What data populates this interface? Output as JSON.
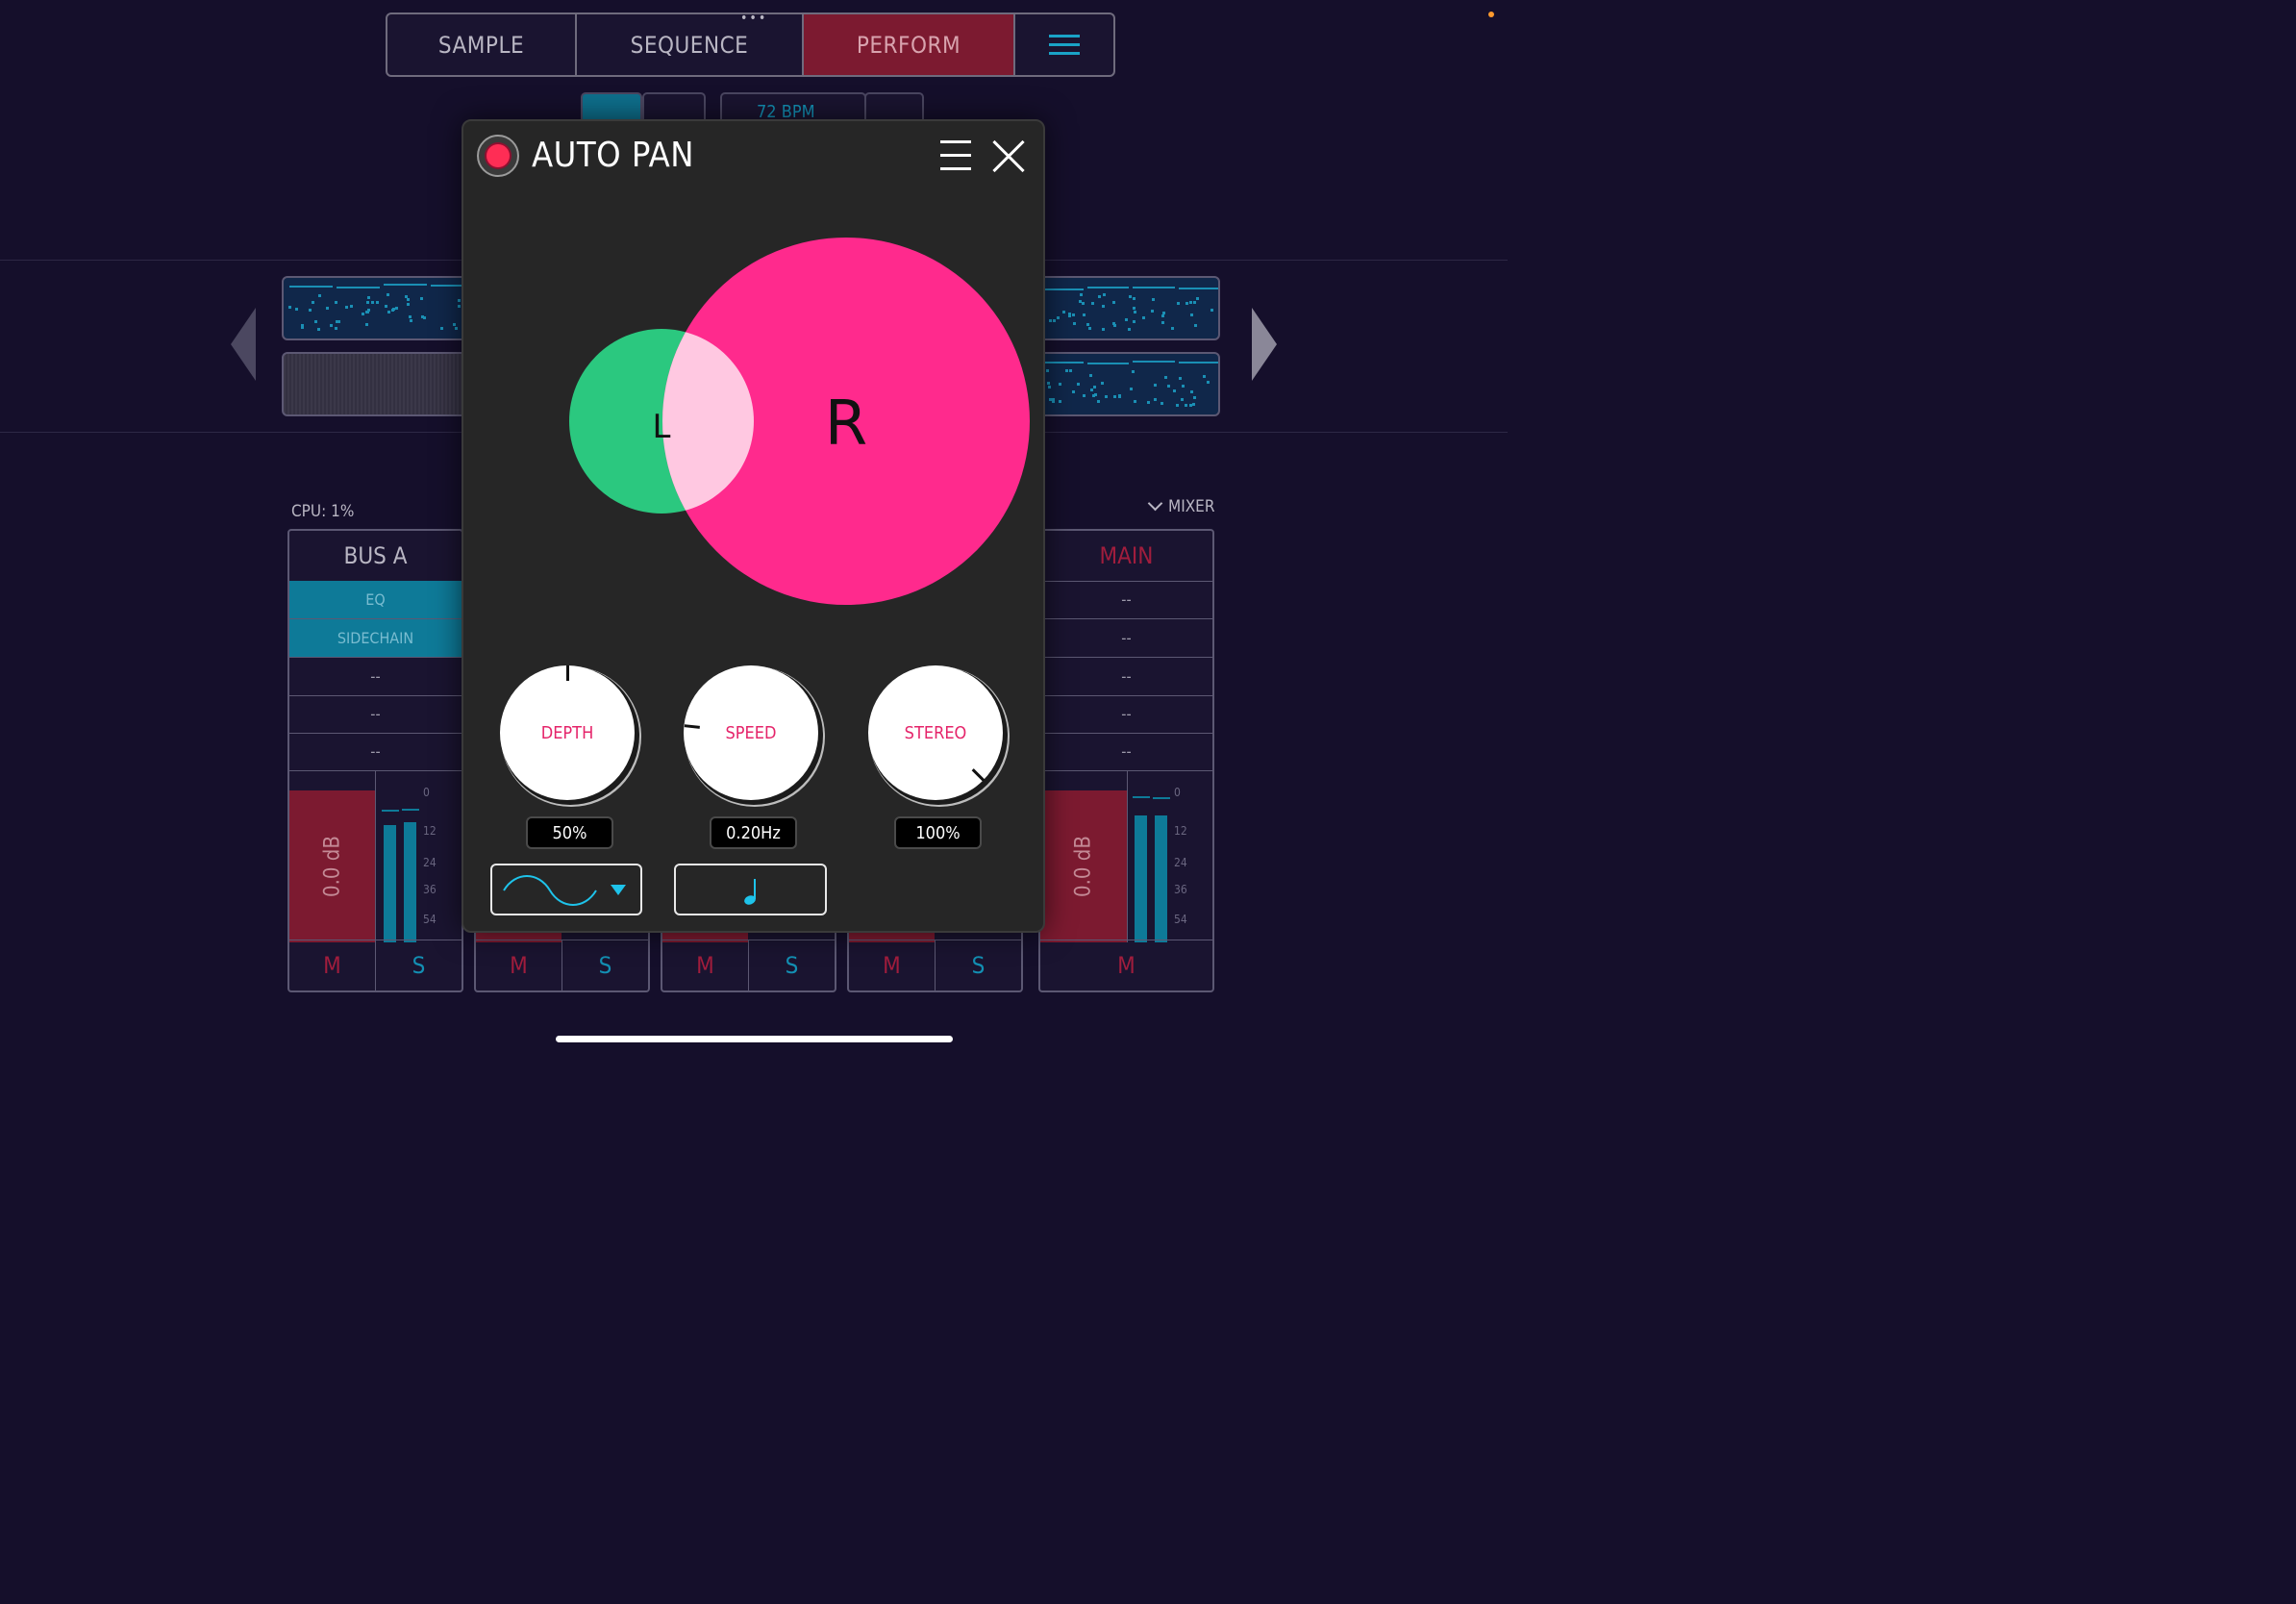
{
  "nav": {
    "tabs": [
      "SAMPLE",
      "SEQUENCE",
      "PERFORM"
    ],
    "active_tab": "PERFORM",
    "menu_icon": "hamburger-icon",
    "dots": "•••"
  },
  "transport": {
    "bpm": "72 BPM"
  },
  "mixer": {
    "cpu": "CPU: 1%",
    "toggle_label": "MIXER",
    "strips": [
      {
        "title": "BUS A",
        "fx": [
          "EQ",
          "SIDECHAIN",
          "--",
          "--",
          "--"
        ],
        "level": "0.0 dB",
        "mute": "M",
        "solo": "S"
      },
      {
        "title": "MAIN",
        "fx": [
          "--",
          "--",
          "--",
          "--",
          "--"
        ],
        "level": "0.0 dB",
        "mute": "M"
      }
    ],
    "hidden_strips": [
      {
        "mute": "M",
        "solo": "S"
      },
      {
        "mute": "M",
        "solo": "S"
      },
      {
        "mute": "M",
        "solo": "S"
      }
    ],
    "meter_scale": [
      "0",
      "12",
      "24",
      "36",
      "54"
    ]
  },
  "popup": {
    "title": "AUTO PAN",
    "left_label": "L",
    "right_label": "R",
    "colors": {
      "left": "#2bc87f",
      "right": "#ff2a8d",
      "overlap": "#ffc8e1",
      "record": "#ff2d55"
    },
    "knobs": [
      {
        "label": "DEPTH",
        "value": "50%"
      },
      {
        "label": "SPEED",
        "value": "0.20Hz"
      },
      {
        "label": "STEREO",
        "value": "100%"
      }
    ],
    "waveform_icon": "sine-wave-icon",
    "sync_icon": "quarter-note-icon"
  }
}
